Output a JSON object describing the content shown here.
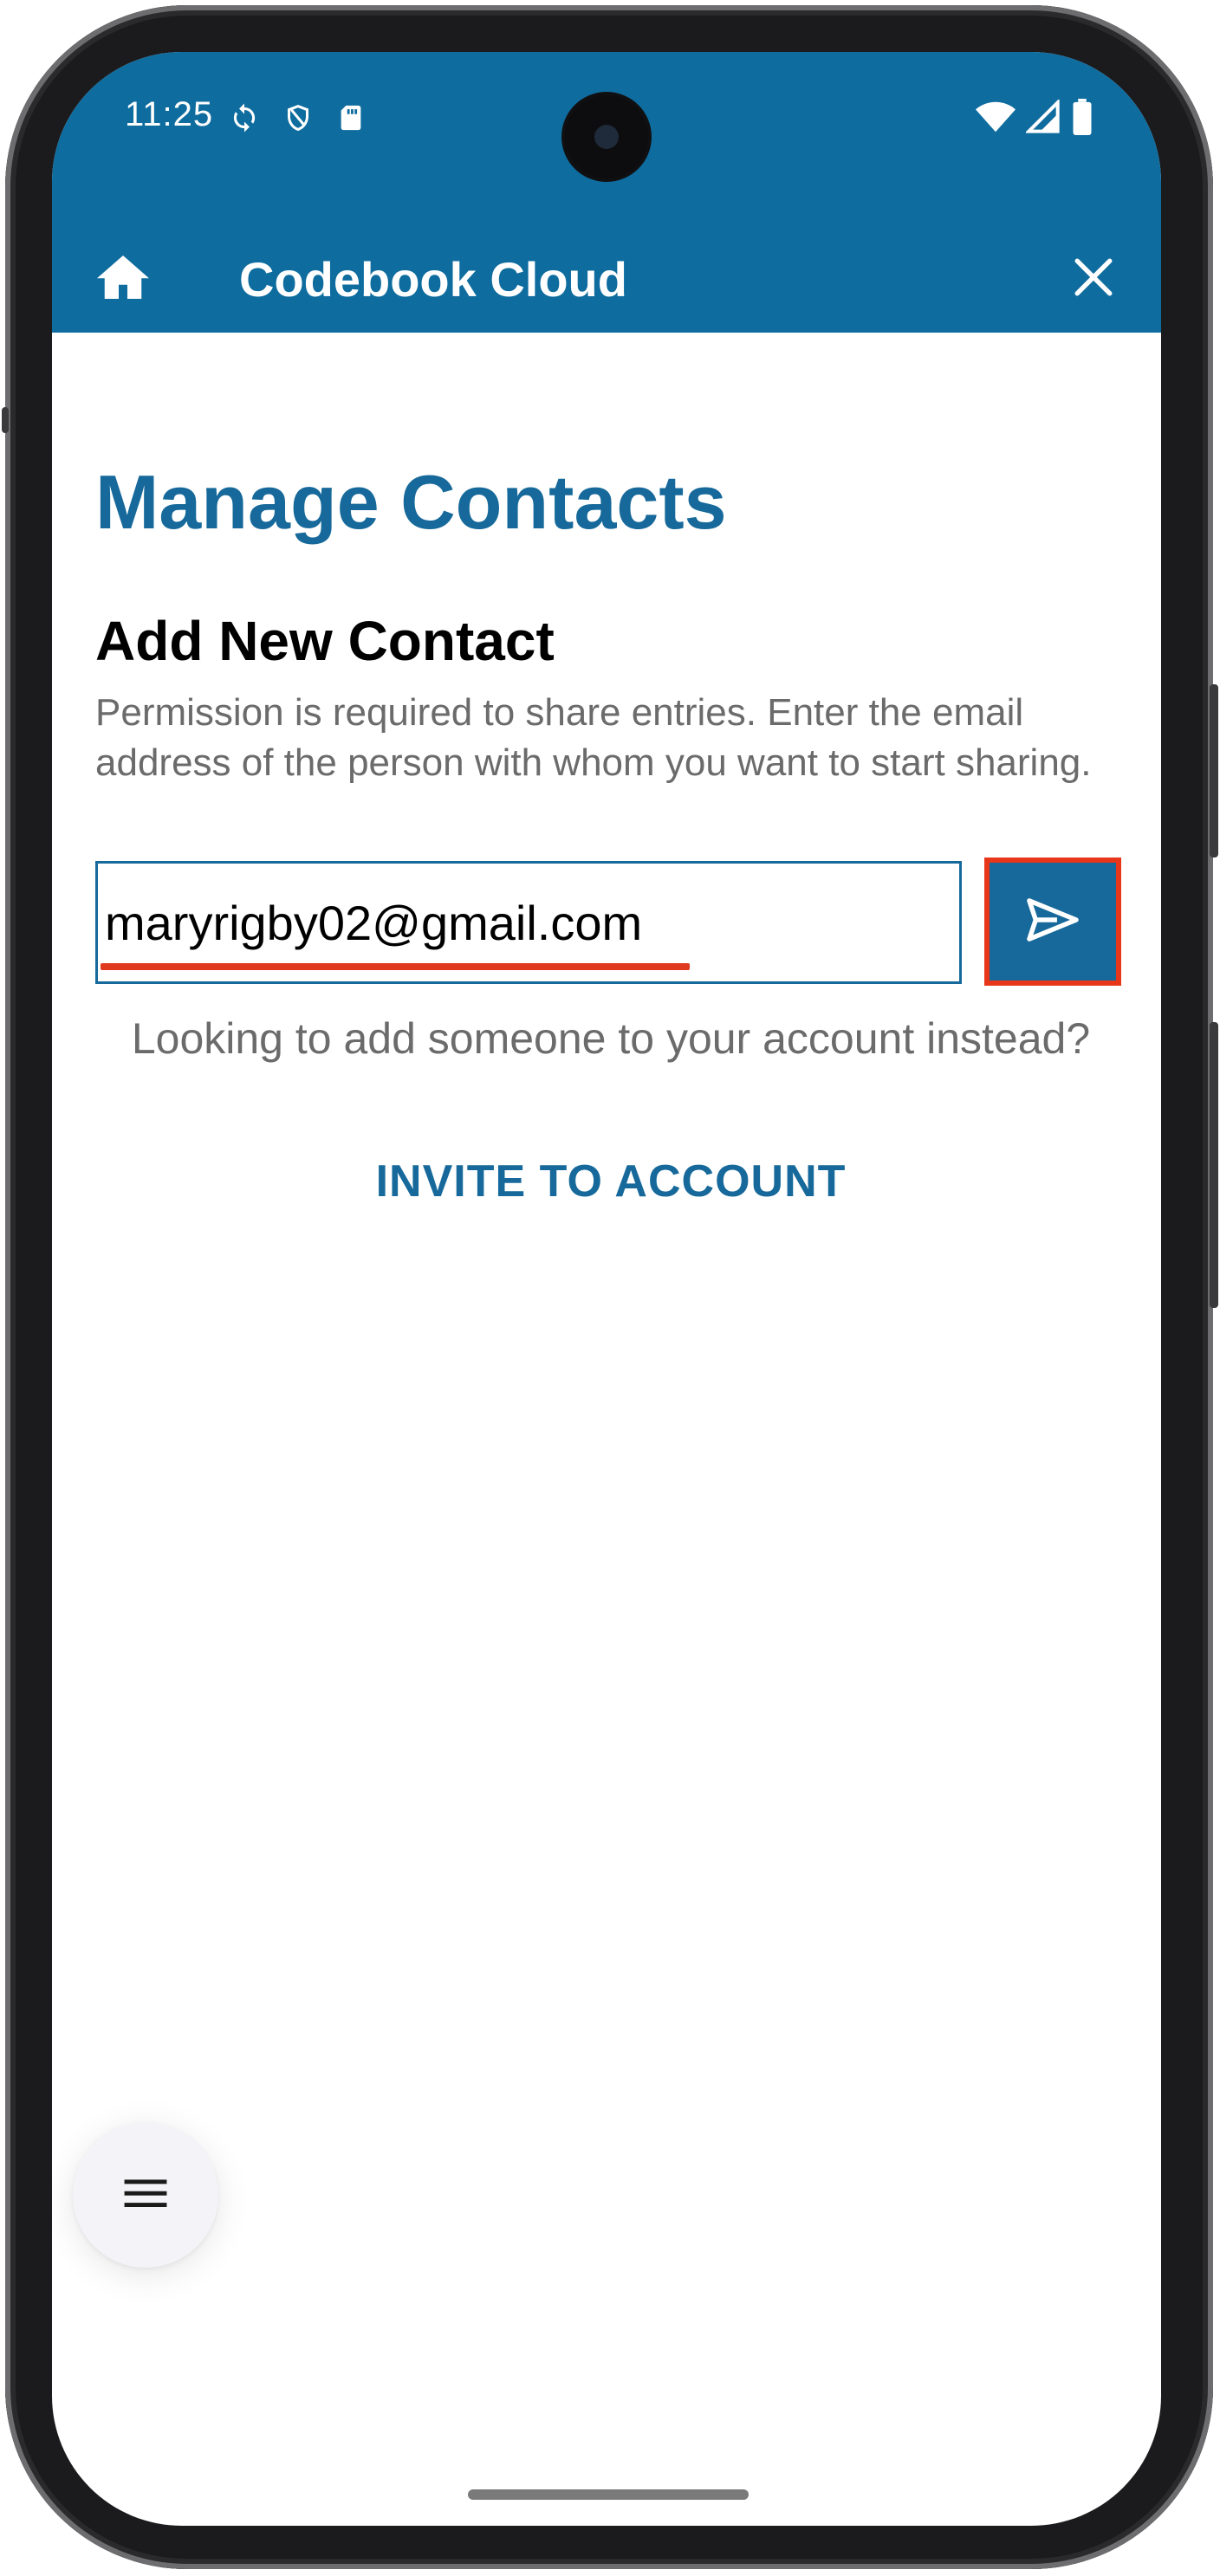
{
  "status_bar": {
    "time": "11:25",
    "icons_left": [
      "sync-icon",
      "shield-icon",
      "sd-card-icon"
    ],
    "icons_right": [
      "wifi-icon",
      "signal-icon",
      "battery-icon"
    ]
  },
  "app_bar": {
    "title": "Codebook Cloud",
    "home_icon": "home-icon",
    "close_icon": "close-icon"
  },
  "page": {
    "title": "Manage Contacts",
    "section_title": "Add New Contact",
    "description": "Permission is required to share entries. Enter the email address of the person with whom you want to start sharing."
  },
  "email_field": {
    "value": "maryrigby02@gmail.com",
    "placeholder": ""
  },
  "send_button": {
    "icon": "send-icon"
  },
  "help": {
    "text": "Looking to add someone to your account instead?",
    "invite_label": "INVITE TO ACCOUNT"
  },
  "fab": {
    "icon": "menu-icon"
  },
  "colors": {
    "primary": "#0e6c9e",
    "accent_highlight": "#e8361a",
    "secondary_text": "#6b6b6b"
  }
}
